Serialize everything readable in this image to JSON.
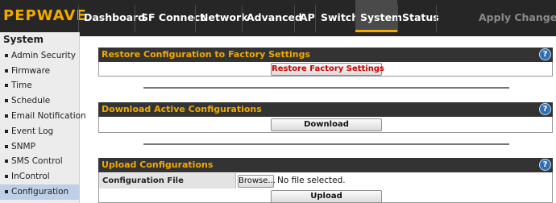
{
  "brand": {
    "logo_text": "PEPWAVE",
    "accent": "#f2a900"
  },
  "nav": {
    "tabs": [
      "Dashboard",
      "SF Connect",
      "Network",
      "Advanced",
      "AP",
      "Switch",
      "System",
      "Status"
    ],
    "active": "System",
    "apply_label": "Apply Changes"
  },
  "sidebar": {
    "title": "System",
    "items": [
      "Admin Security",
      "Firmware",
      "Time",
      "Schedule",
      "Email Notification",
      "Event Log",
      "SNMP",
      "SMS Control",
      "InControl",
      "Configuration"
    ],
    "active": "Configuration"
  },
  "sections": {
    "restore": {
      "title": "Restore Configuration to Factory Settings",
      "button": "Restore Factory Settings",
      "button_color": "#cc0000"
    },
    "download": {
      "title": "Download Active Configurations",
      "button": "Download"
    },
    "upload": {
      "title": "Upload Configurations",
      "field_label": "Configuration File",
      "browse": "Browse...",
      "file_status": "No file selected.",
      "button": "Upload"
    }
  },
  "help_icon": "question-mark-icon"
}
